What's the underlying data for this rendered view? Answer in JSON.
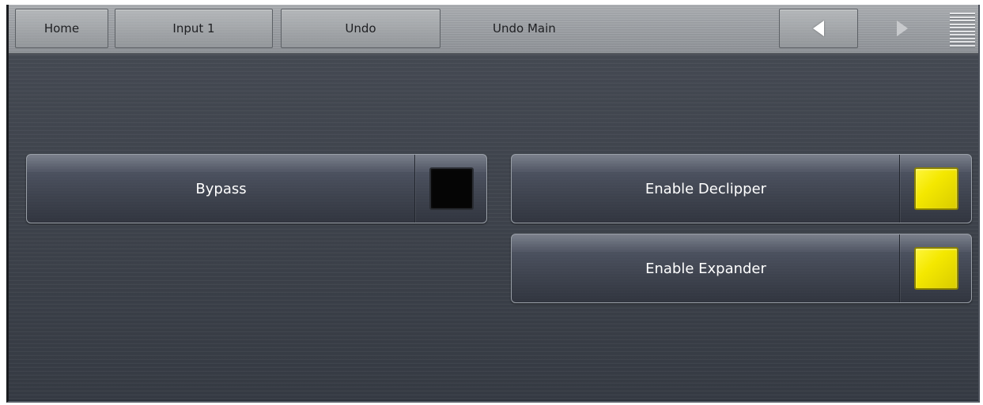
{
  "nav": {
    "home_label": "Home",
    "input_label": "Input 1",
    "undo_label": "Undo",
    "current_page": "Undo Main",
    "back_icon": "left-arrow-icon",
    "forward_icon": "right-arrow-icon",
    "menu_icon": "menu-icon"
  },
  "controls": {
    "bypass": {
      "label": "Bypass",
      "state": "off"
    },
    "declipper": {
      "label": "Enable Declipper",
      "state": "on"
    },
    "expander": {
      "label": "Enable Expander",
      "state": "on"
    }
  },
  "colors": {
    "indicator_on": "#f4e800",
    "indicator_off": "#050505"
  }
}
